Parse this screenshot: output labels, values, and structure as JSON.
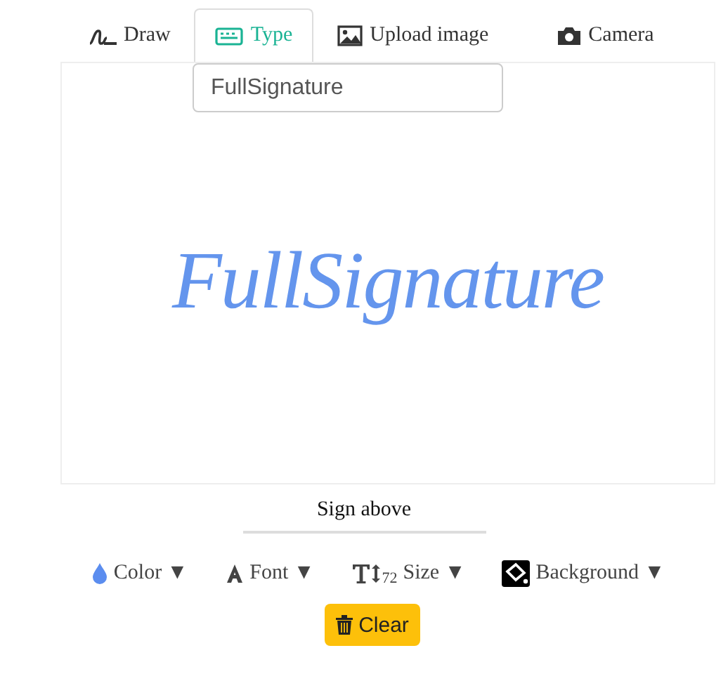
{
  "tabs": [
    {
      "label": "Draw",
      "kind": "draw",
      "selected": false
    },
    {
      "label": "Type",
      "kind": "type",
      "selected": true
    },
    {
      "label": "Upload image",
      "kind": "upload",
      "selected": false
    },
    {
      "label": "Camera",
      "kind": "camera",
      "selected": false
    }
  ],
  "name_field": {
    "value": "FullSignature"
  },
  "signature": "FullSignature",
  "caption": "Sign above",
  "toolbar": [
    {
      "label": "Color",
      "kind": "color",
      "caret": "▼"
    },
    {
      "label": "Font",
      "kind": "font",
      "caret": "▼"
    },
    {
      "label": "Size",
      "kind": "size",
      "size_value": "72",
      "caret": "▼"
    },
    {
      "label": "Background",
      "kind": "background",
      "caret": "▼"
    }
  ],
  "clear_button": {
    "label": "Clear"
  }
}
